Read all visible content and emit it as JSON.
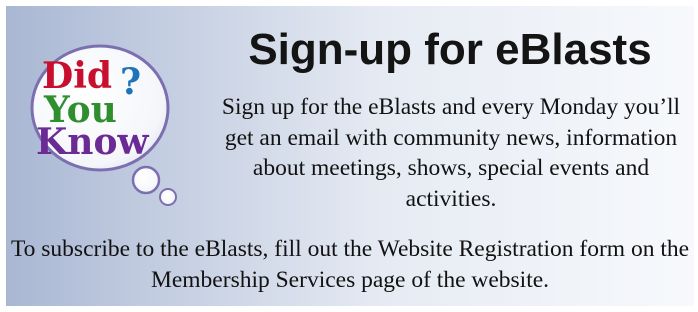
{
  "badge": {
    "icon": "did-you-know-bubble-icon",
    "line1": "Did",
    "line2": "You",
    "line3": "Know",
    "question_mark": "?",
    "colors": {
      "did": "#c8102e",
      "you": "#2f8f2f",
      "know": "#6a2b94",
      "question": "#1f73b8"
    }
  },
  "title": "Sign-up for eBlasts",
  "intro": "Sign up for the eBlasts and every Monday you’ll get an email with community news, information about meetings, shows, special events and activities.",
  "subscribe": "To subscribe to the eBlasts, fill out the Website Registration form on the Membership Services page of the website."
}
